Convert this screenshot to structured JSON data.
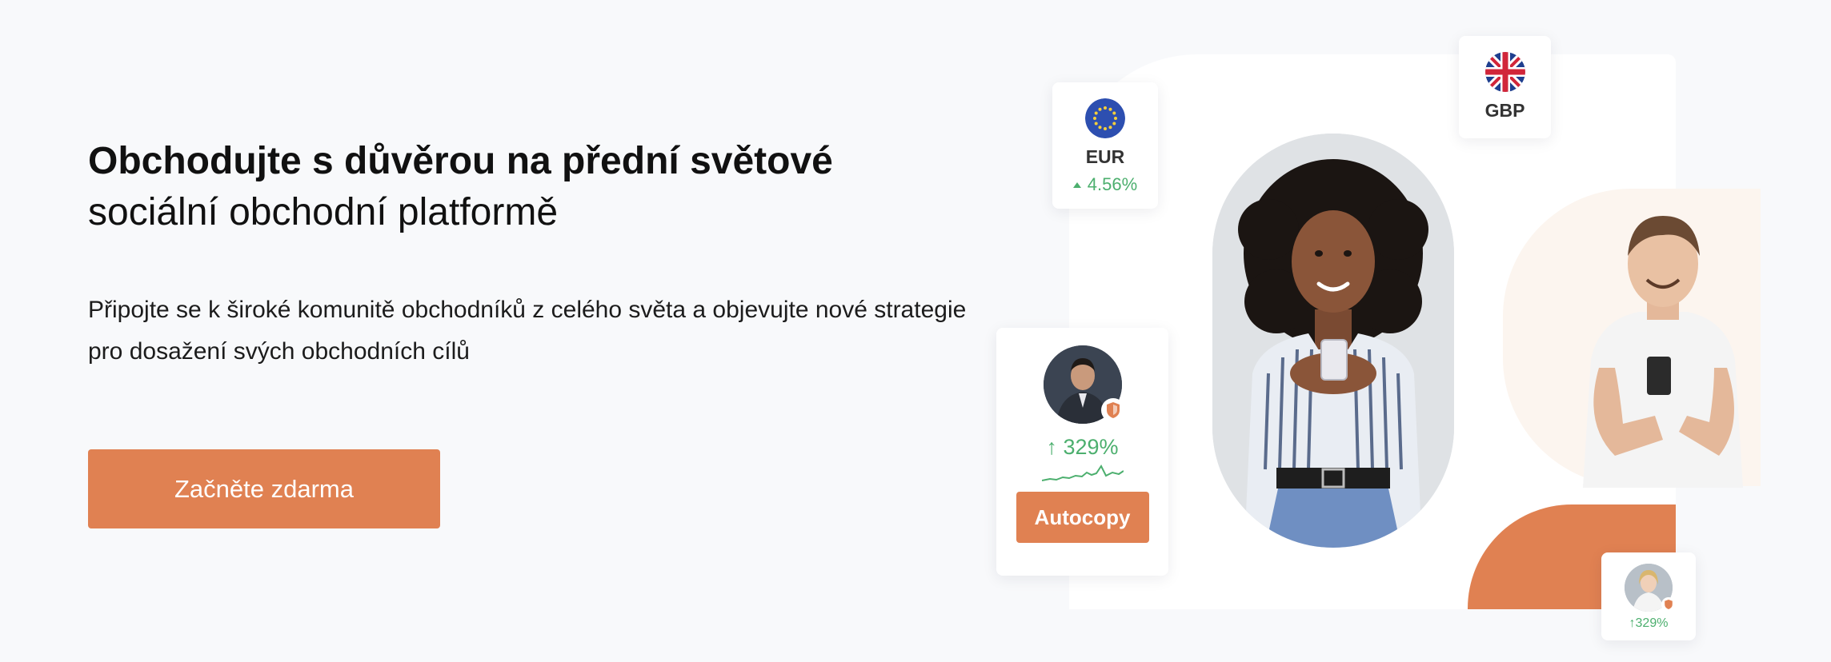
{
  "hero": {
    "title_bold": "Obchodujte s důvěrou na přední světové",
    "title_regular": " sociální obchodní platformě",
    "subtitle": "Připojte se k široké komunitě obchodníků z celého světa a objevujte nové strategie pro dosažení svých obchodních cílů",
    "cta_label": "Začněte zdarma"
  },
  "currency_cards": [
    {
      "code": "EUR",
      "change": "4.56%",
      "flag_icon": "eu-flag-icon"
    },
    {
      "code": "GBP",
      "flag_icon": "uk-flag-icon"
    }
  ],
  "trader_card": {
    "gain": "↑ 329%",
    "autocopy_label": "Autocopy"
  },
  "mini_card": {
    "gain": "↑329%"
  },
  "colors": {
    "accent": "#e08152",
    "positive": "#4caf6e",
    "background": "#f8f9fb"
  }
}
